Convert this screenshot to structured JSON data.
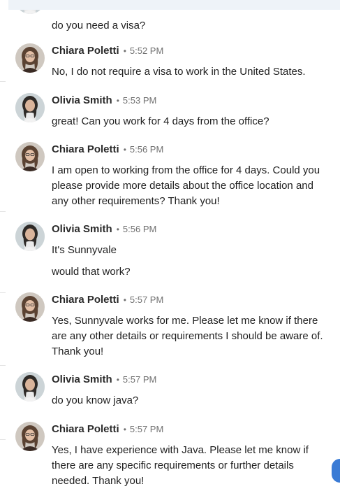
{
  "thread": {
    "first_fragment": {
      "text": "do you need a visa?"
    },
    "messages": [
      {
        "sender": "Chiara Poletti",
        "time": "5:52 PM",
        "avatar": "chiara-avatar",
        "lines": [
          "No, I do not require a visa to work in the United States."
        ]
      },
      {
        "sender": "Olivia Smith",
        "time": "5:53 PM",
        "avatar": "olivia-avatar",
        "lines": [
          "great! Can you work for 4 days from the office?"
        ]
      },
      {
        "sender": "Chiara Poletti",
        "time": "5:56 PM",
        "avatar": "chiara-avatar",
        "lines": [
          "I am open to working from the office for 4 days. Could you please provide more details about the office location and any other requirements? Thank you!"
        ]
      },
      {
        "sender": "Olivia Smith",
        "time": "5:56 PM",
        "avatar": "olivia-avatar",
        "lines": [
          "It's Sunnyvale",
          "would that work?"
        ]
      },
      {
        "sender": "Chiara Poletti",
        "time": "5:57 PM",
        "avatar": "chiara-avatar",
        "lines": [
          "Yes, Sunnyvale works for me. Please let me know if there are any other details or requirements I should be aware of. Thank you!"
        ]
      },
      {
        "sender": "Olivia Smith",
        "time": "5:57 PM",
        "avatar": "olivia-avatar",
        "lines": [
          "do you know java?"
        ]
      },
      {
        "sender": "Chiara Poletti",
        "time": "5:57 PM",
        "avatar": "chiara-avatar",
        "lines": [
          "Yes, I have experience with Java. Please let me know if there are any specific requirements or further details needed. Thank you!"
        ]
      }
    ]
  },
  "colors": {
    "accent": "#3a7bd5",
    "meta_gray": "#707070"
  }
}
